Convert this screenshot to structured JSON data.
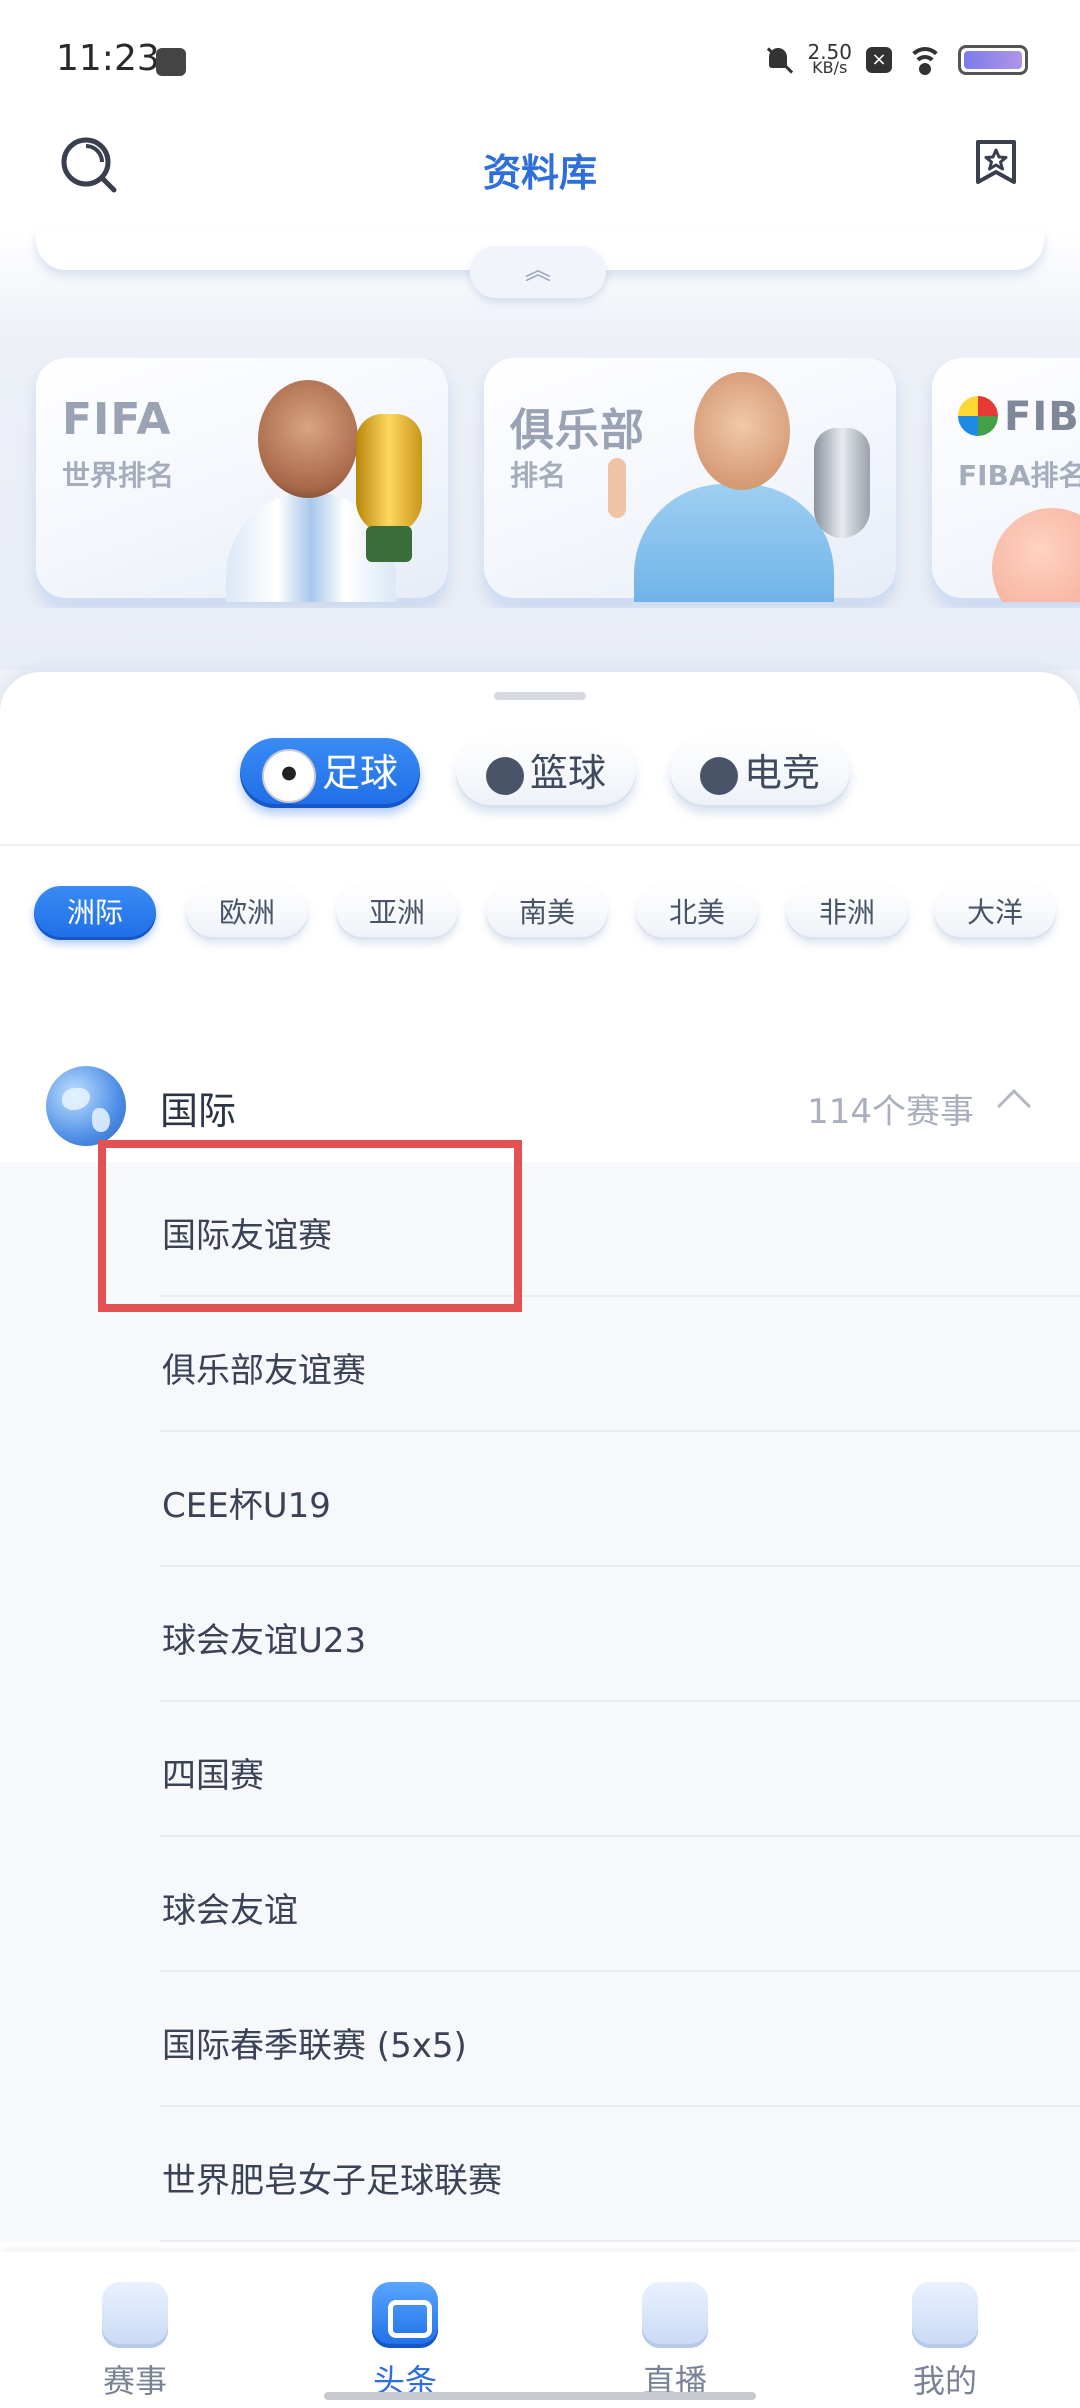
{
  "status_bar": {
    "time": "11:23",
    "net_speed_value": "2.50",
    "net_speed_unit": "KB/s",
    "icons": [
      "message-icon",
      "bell-off-icon",
      "close-box-icon",
      "wifi-icon",
      "battery-icon"
    ]
  },
  "nav": {
    "title": "资料库",
    "left_icon": "search-icon",
    "right_icon": "bookmark-star-icon"
  },
  "rank_cards": [
    {
      "title": "FIFA",
      "subtitle": "世界排名"
    },
    {
      "title": "俱乐部",
      "subtitle": "排名"
    },
    {
      "title": "FIBA",
      "subtitle": "FIBA排名"
    }
  ],
  "sport_tabs": [
    {
      "label": "足球",
      "icon": "soccer-ball-icon",
      "active": true
    },
    {
      "label": "篮球",
      "icon": "basketball-icon",
      "active": false
    },
    {
      "label": "电竞",
      "icon": "esports-icon",
      "active": false
    }
  ],
  "region_tabs": [
    "洲际",
    "欧洲",
    "亚洲",
    "南美",
    "北美",
    "非洲",
    "大洋"
  ],
  "group": {
    "title": "国际",
    "count": "114个赛事"
  },
  "competitions": [
    "国际友谊赛",
    "俱乐部友谊赛",
    "CEE杯U19",
    "球会友谊U23",
    "四国赛",
    "球会友谊",
    "国际春季联赛 (5x5)",
    "世界肥皂女子足球联赛"
  ],
  "bottom_tabs": [
    {
      "label": "赛事",
      "active": false
    },
    {
      "label": "头条",
      "active": true
    },
    {
      "label": "直播",
      "active": false
    },
    {
      "label": "我的",
      "active": false
    }
  ],
  "colors": {
    "accent": "#2f6fdb",
    "highlight": "#e35252"
  }
}
